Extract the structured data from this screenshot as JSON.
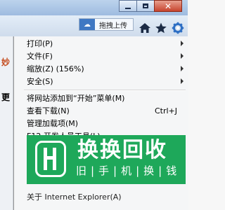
{
  "toolbar": {
    "upload_label": "拖拽上传"
  },
  "menu": {
    "items": [
      {
        "label": "打印(P)"
      },
      {
        "label": "文件(F)"
      },
      {
        "label": "缩放(Z) (156%)"
      },
      {
        "label": "安全(S)"
      },
      {
        "label": "将网站添加到“开始”菜单(M)"
      },
      {
        "label": "查看下载(N)",
        "shortcut": "Ctrl+J"
      },
      {
        "label": "管理加载项(M)"
      },
      {
        "label": "F12 开发人员工具(L)"
      },
      {
        "label": "关于 Internet Explorer(A)"
      }
    ]
  },
  "watermark": {
    "title": "换换回收",
    "subtitle": "旧|手|机|换|钱"
  },
  "colors": {
    "watermark_green": "#1ea85a",
    "menu_background": "#f5f6f7",
    "close_button": "#c7442e"
  }
}
